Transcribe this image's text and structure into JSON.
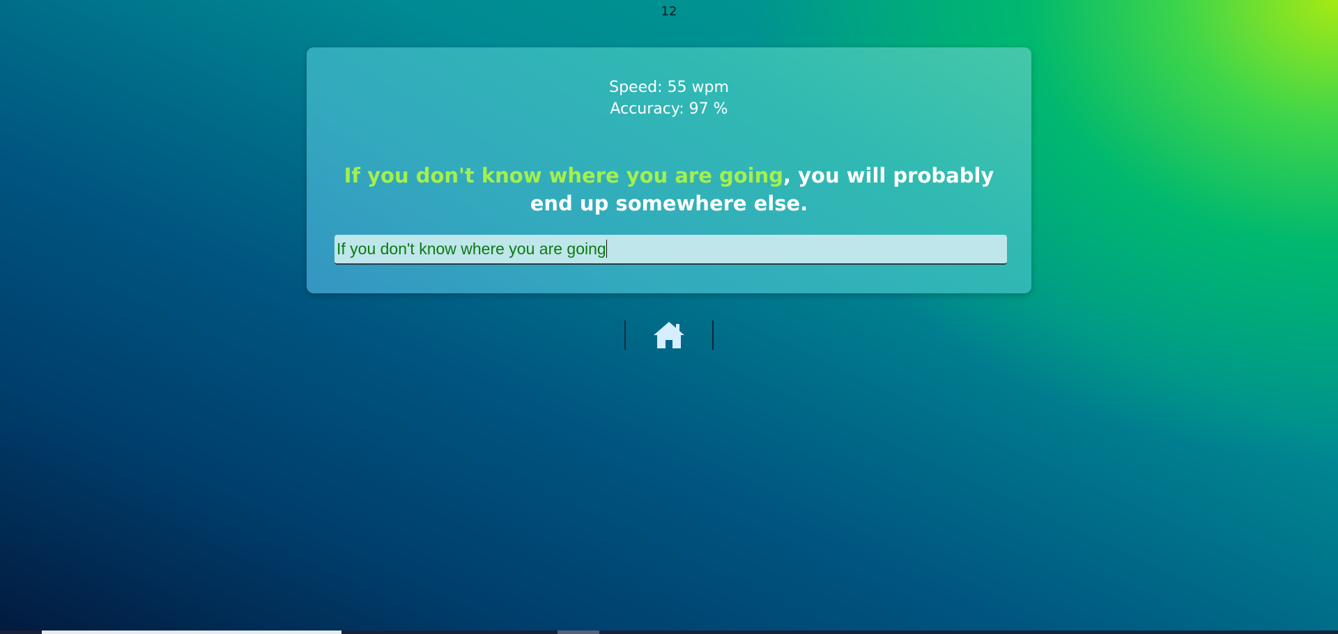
{
  "timer": {
    "seconds": "12"
  },
  "stats": {
    "speed": "Speed: 55 wpm",
    "accuracy": "Accuracy: 97 %"
  },
  "quote": {
    "typed": "If you don't know where you are going",
    "remaining": ", you will probably end up somewhere else."
  },
  "input": {
    "value": "If you don't know where you are going"
  },
  "nav": {
    "home_icon": "home-icon"
  },
  "colors": {
    "typed_text": "#a4f04d",
    "remaining_text": "#ffffff",
    "input_text": "#0a7a12",
    "input_background": "#bfe6ea"
  }
}
